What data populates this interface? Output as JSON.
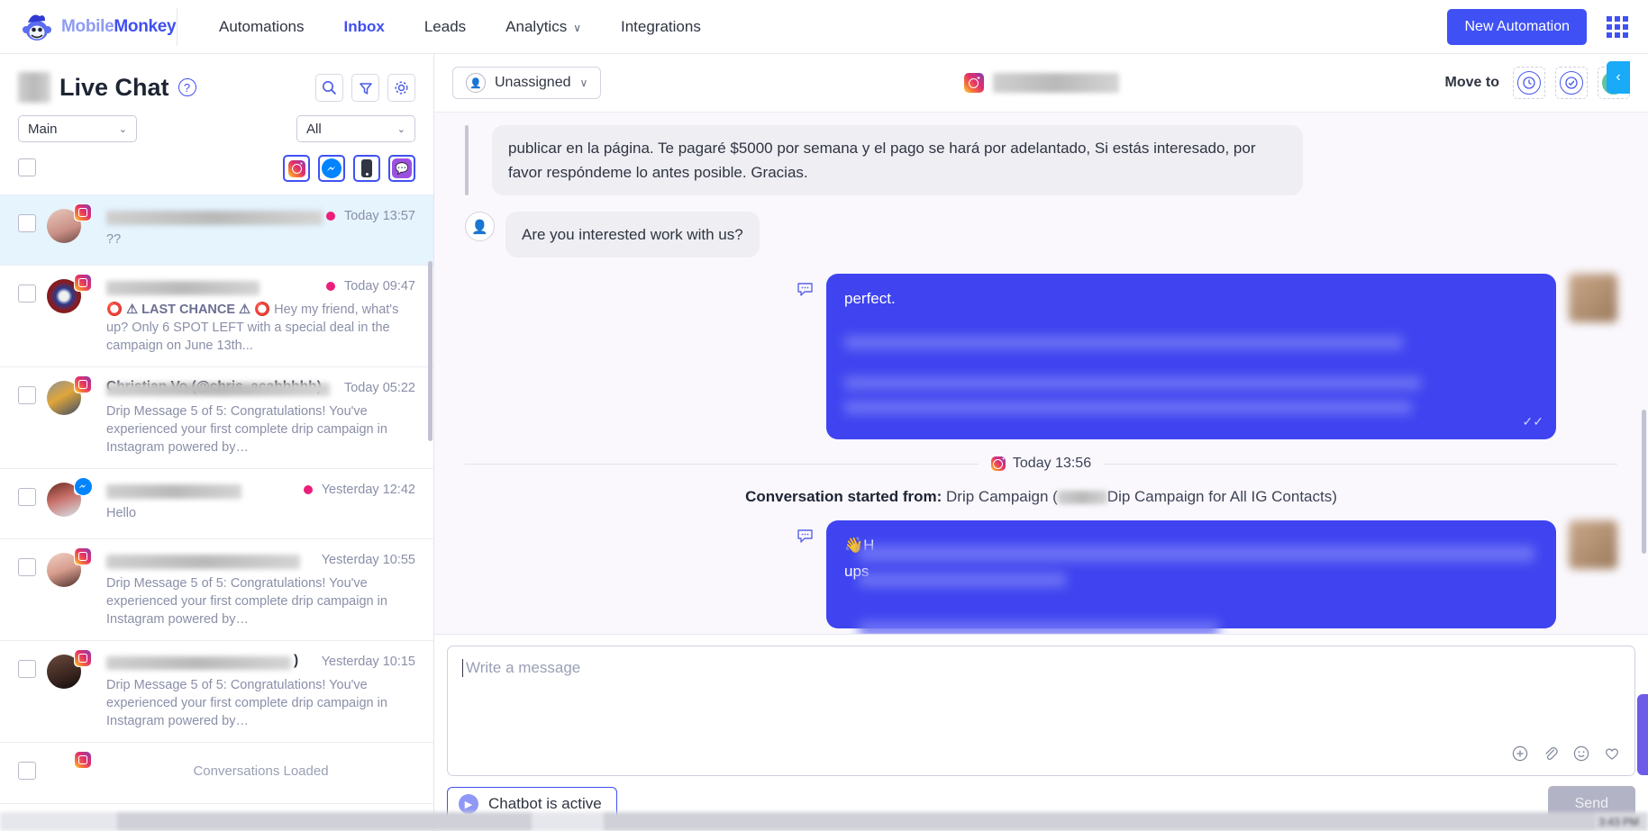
{
  "topnav": {
    "brand_part1": "Mobile",
    "brand_part2": "Monkey",
    "links": [
      {
        "label": "Automations",
        "active": false,
        "caret": ""
      },
      {
        "label": "Inbox",
        "active": true,
        "caret": ""
      },
      {
        "label": "Leads",
        "active": false,
        "caret": ""
      },
      {
        "label": "Analytics",
        "active": false,
        "caret": "∨"
      },
      {
        "label": "Integrations",
        "active": false,
        "caret": ""
      }
    ],
    "new_automation_label": "New Automation",
    "apps_icon": "grid-apps-icon"
  },
  "sidebar": {
    "title": "Live Chat",
    "help_icon": "question-mark-icon",
    "search_icon": "search-icon",
    "filter_icon": "funnel-filter-icon",
    "settings_icon": "gear-icon",
    "page_select": {
      "value": "Main",
      "chevron": "⌄"
    },
    "status_select": {
      "value": "All",
      "chevron": "⌄"
    },
    "channels": [
      {
        "name": "instagram-channel-filter",
        "active": true
      },
      {
        "name": "messenger-channel-filter",
        "active": true
      },
      {
        "name": "sms-channel-filter",
        "active": true
      },
      {
        "name": "webchat-channel-filter",
        "active": true
      }
    ],
    "select_all_checkbox": false,
    "conversations": [
      {
        "name_redacted": true,
        "name": "",
        "channel": "instagram",
        "snippet": "??",
        "snippet_bold": "",
        "time": "Today 13:57",
        "unread": true,
        "active": true
      },
      {
        "name_redacted": true,
        "name": "",
        "channel": "instagram",
        "snippet_bold": "⭕ ⚠ LAST CHANCE ⚠ ⭕",
        "snippet": " Hey my friend, what's up? Only 6 SPOT LEFT with a special deal in the campaign on June 13th...",
        "time": "Today 09:47",
        "unread": true,
        "active": false
      },
      {
        "name_redacted": true,
        "name": "Christian Vo (@chris_acahhhhh)",
        "channel": "instagram",
        "snippet": "Drip Message 5 of 5: Congratulations! You've experienced your first complete drip campaign in Instagram powered by…",
        "snippet_bold": "",
        "time": "Today 05:22",
        "unread": false,
        "active": false
      },
      {
        "name_redacted": true,
        "name": "",
        "channel": "messenger",
        "snippet": "Hello",
        "snippet_bold": "",
        "time": "Yesterday 12:42",
        "unread": true,
        "active": false
      },
      {
        "name_redacted": true,
        "name": "",
        "channel": "instagram",
        "snippet": "Drip Message 5 of 5: Congratulations! You've experienced your first complete drip campaign in Instagram powered by…",
        "snippet_bold": "",
        "time": "Yesterday 10:55",
        "unread": false,
        "active": false
      },
      {
        "name_redacted": true,
        "name": ")",
        "channel": "instagram",
        "snippet": "Drip Message 5 of 5: Congratulations! You've experienced your first complete drip campaign in Instagram powered by…",
        "snippet_bold": "",
        "time": "Yesterday 10:15",
        "unread": false,
        "active": false
      },
      {
        "name_redacted": true,
        "name": "",
        "channel": "instagram",
        "snippet": "",
        "snippet_bold": "",
        "time": "",
        "unread": false,
        "active": false
      }
    ],
    "loaded_note": "Conversations Loaded"
  },
  "chat_header": {
    "assignee": "Unassigned",
    "assignee_chevron": "∨",
    "contact_channel_icon": "instagram-icon",
    "contact_name_redacted": true,
    "move_to_label": "Move to",
    "move_buttons": [
      {
        "name": "move-to-pending-icon",
        "glyph": "◴"
      },
      {
        "name": "move-to-done-icon",
        "glyph": "✓"
      },
      {
        "name": "move-to-closed-icon",
        "glyph": "✓"
      }
    ],
    "collapse_icon": "‹"
  },
  "thread": {
    "messages": [
      {
        "type": "incoming-quoted",
        "text": "publicar en la página. Te pagaré $5000 por semana y el pago se hará por adelantado, Si estás interesado, por favor respóndeme lo antes posible. Gracias."
      },
      {
        "type": "incoming",
        "text": "Are you interested work with us?"
      },
      {
        "type": "outgoing",
        "text": "perfect.",
        "redacted_lines": 2,
        "status": "✓✓"
      }
    ],
    "day_divider": {
      "icon": "instagram-icon",
      "label": "Today 13:56"
    },
    "started_from_label": "Conversation started from:",
    "started_from_value_1": "Drip Campaign (",
    "started_from_value_2": "Dip Campaign for All IG Contacts)",
    "second_message": {
      "type": "outgoing",
      "emoji": "👋",
      "visible_fragment_1": "H",
      "visible_fragment_2": "ups",
      "redacted": true
    }
  },
  "composer": {
    "placeholder": "Write a message",
    "value": "",
    "icons": [
      {
        "name": "add-plus-icon",
        "glyph": "⊕"
      },
      {
        "name": "attachment-paperclip-icon",
        "glyph": "📎"
      },
      {
        "name": "emoji-smiley-icon",
        "glyph": "☺"
      },
      {
        "name": "like-heart-icon",
        "glyph": "♡"
      }
    ],
    "chatbot_status": "Chatbot is active",
    "chatbot_play_icon": "play-icon",
    "send_label": "Send"
  },
  "taskbar": {
    "clock": "3:43 PM"
  },
  "colors": {
    "accent": "#3f51f5",
    "bubble_outgoing": "#3f44f0",
    "unread_dot": "#ec1e79",
    "chat_bg": "#faf8fd",
    "active_conv": "#e5f4fd",
    "move_green": "#63c2a0",
    "collapse_blue": "#19aaf8"
  }
}
